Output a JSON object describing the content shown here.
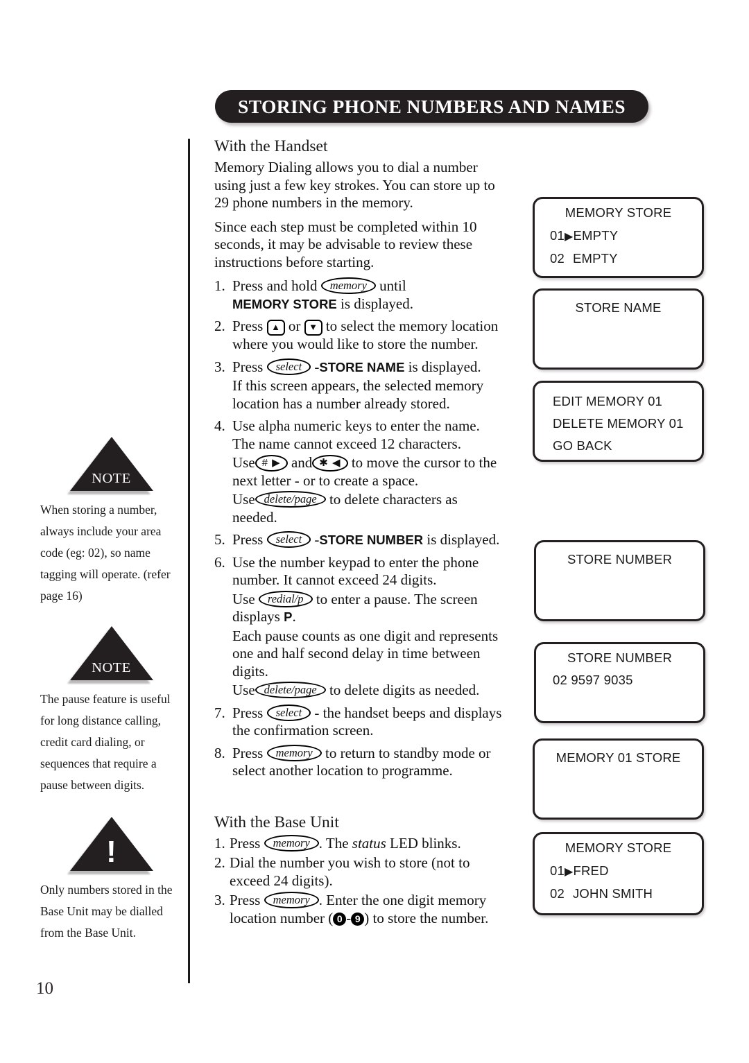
{
  "page": {
    "number": "10",
    "header_title": "STORING PHONE NUMBERS AND NAMES"
  },
  "notes": [
    {
      "icon": "note-triangle-icon",
      "label": "NOTE",
      "text": "When storing a number, always include your area code (eg: 02), so name tagging will operate. (refer page 16)"
    },
    {
      "icon": "note-triangle-icon",
      "label": "NOTE",
      "text": "The pause feature is useful for long distance calling, credit card dialing, or sequences that require a pause between digits."
    },
    {
      "icon": "warning-triangle-icon",
      "label": "!",
      "text": "Only numbers stored in the Base Unit may be dialled from the Base Unit."
    }
  ],
  "handset": {
    "heading": "With the Handset",
    "intro1": "Memory Dialing allows you to dial a number using just a few key strokes. You can store up to 29 phone numbers in the memory.",
    "intro2": "Since each step must be completed within 10 seconds, it may be advisable to review these instructions before starting.",
    "steps": [
      {
        "num": "1.",
        "pre": "Press and hold",
        "key": "memory",
        "post": "until",
        "line2_bold": "MEMORY STORE",
        "line2_rest": " is displayed."
      },
      {
        "num": "2.",
        "pre": "Press",
        "key_up": "▲",
        "mid": "or",
        "key_down": "▼",
        "post": "to select the memory location where you would like to store the number."
      },
      {
        "num": "3.",
        "pre": "Press",
        "key": "select",
        "dash": "-",
        "bold": "STORE NAME",
        "post": "is displayed.",
        "line2": "If this screen appears, the selected memory location has a number already stored."
      },
      {
        "num": "4.",
        "line1": "Use alpha numeric keys to enter the name. The name cannot exceed 12 characters.",
        "sub1_pre": "Use",
        "sub1_key1": "# ▶",
        "sub1_mid": "and",
        "sub1_key2": "✱ ◀",
        "sub1_post": "to move the cursor to the next letter - or to create a space.",
        "sub2_pre": "Use",
        "sub2_key": "delete/page",
        "sub2_post": "to delete characters as needed."
      },
      {
        "num": "5.",
        "pre": "Press",
        "key": "select",
        "dash": "-",
        "bold": "STORE NUMBER",
        "post": "is displayed."
      },
      {
        "num": "6.",
        "line1": "Use the number keypad to enter the phone number. It cannot exceed 24 digits.",
        "sub1_pre": "Use",
        "sub1_key": "redial/p",
        "sub1_post": "to enter a pause. The screen displays",
        "sub1_bold": "P",
        "sub1_end": ".",
        "sub2": "Each pause counts as one digit and represents one and half second delay in time between digits.",
        "sub3_pre": "Use",
        "sub3_key": "delete/page",
        "sub3_post": "to delete digits as needed."
      },
      {
        "num": "7.",
        "pre": "Press",
        "key": "select",
        "post": "- the handset beeps and displays the confirmation screen."
      },
      {
        "num": "8.",
        "pre": "Press",
        "key": "memory",
        "post": "to return to standby mode or select another location to programme."
      }
    ]
  },
  "base_unit": {
    "heading": "With the Base  Unit",
    "steps": [
      {
        "num": "1.",
        "pre": "Press",
        "key": "memory",
        "post": ". The",
        "italic": "status",
        "post2": "LED blinks."
      },
      {
        "num": "2.",
        "text": "Dial the number you wish to store (not to exceed 24 digits)."
      },
      {
        "num": "3.",
        "pre": "Press",
        "key": "memory",
        "post": ". Enter the one digit memory location number",
        "key_lo": "0",
        "key_dash": "-",
        "key_hi": "9",
        "post2": ") to store the number."
      }
    ]
  },
  "lcd_screens": [
    {
      "id": "memory-store-empty",
      "title": "MEMORY STORE",
      "rows": [
        {
          "index": "01",
          "cursor": "▶",
          "label": "EMPTY"
        },
        {
          "index": "02",
          "cursor": "",
          "label": "EMPTY"
        }
      ]
    },
    {
      "id": "store-name",
      "title": "STORE NAME",
      "rows": []
    },
    {
      "id": "edit-delete-menu",
      "title": "",
      "lines": [
        "EDIT MEMORY 01",
        "DELETE MEMORY 01",
        "GO BACK"
      ]
    },
    {
      "id": "store-number-empty",
      "title": "STORE NUMBER",
      "rows": []
    },
    {
      "id": "store-number-filled",
      "title": "STORE NUMBER",
      "value": "02 9597 9035"
    },
    {
      "id": "memory-01-store",
      "title": "MEMORY 01 STORE",
      "rows": []
    },
    {
      "id": "memory-store-filled",
      "title": "MEMORY STORE",
      "rows": [
        {
          "index": "01",
          "cursor": "▶",
          "label": "FRED"
        },
        {
          "index": "02",
          "cursor": "",
          "label": "JOHN SMITH"
        }
      ]
    }
  ],
  "colors": {
    "ink": "#231f20",
    "paper": "#ffffff"
  }
}
